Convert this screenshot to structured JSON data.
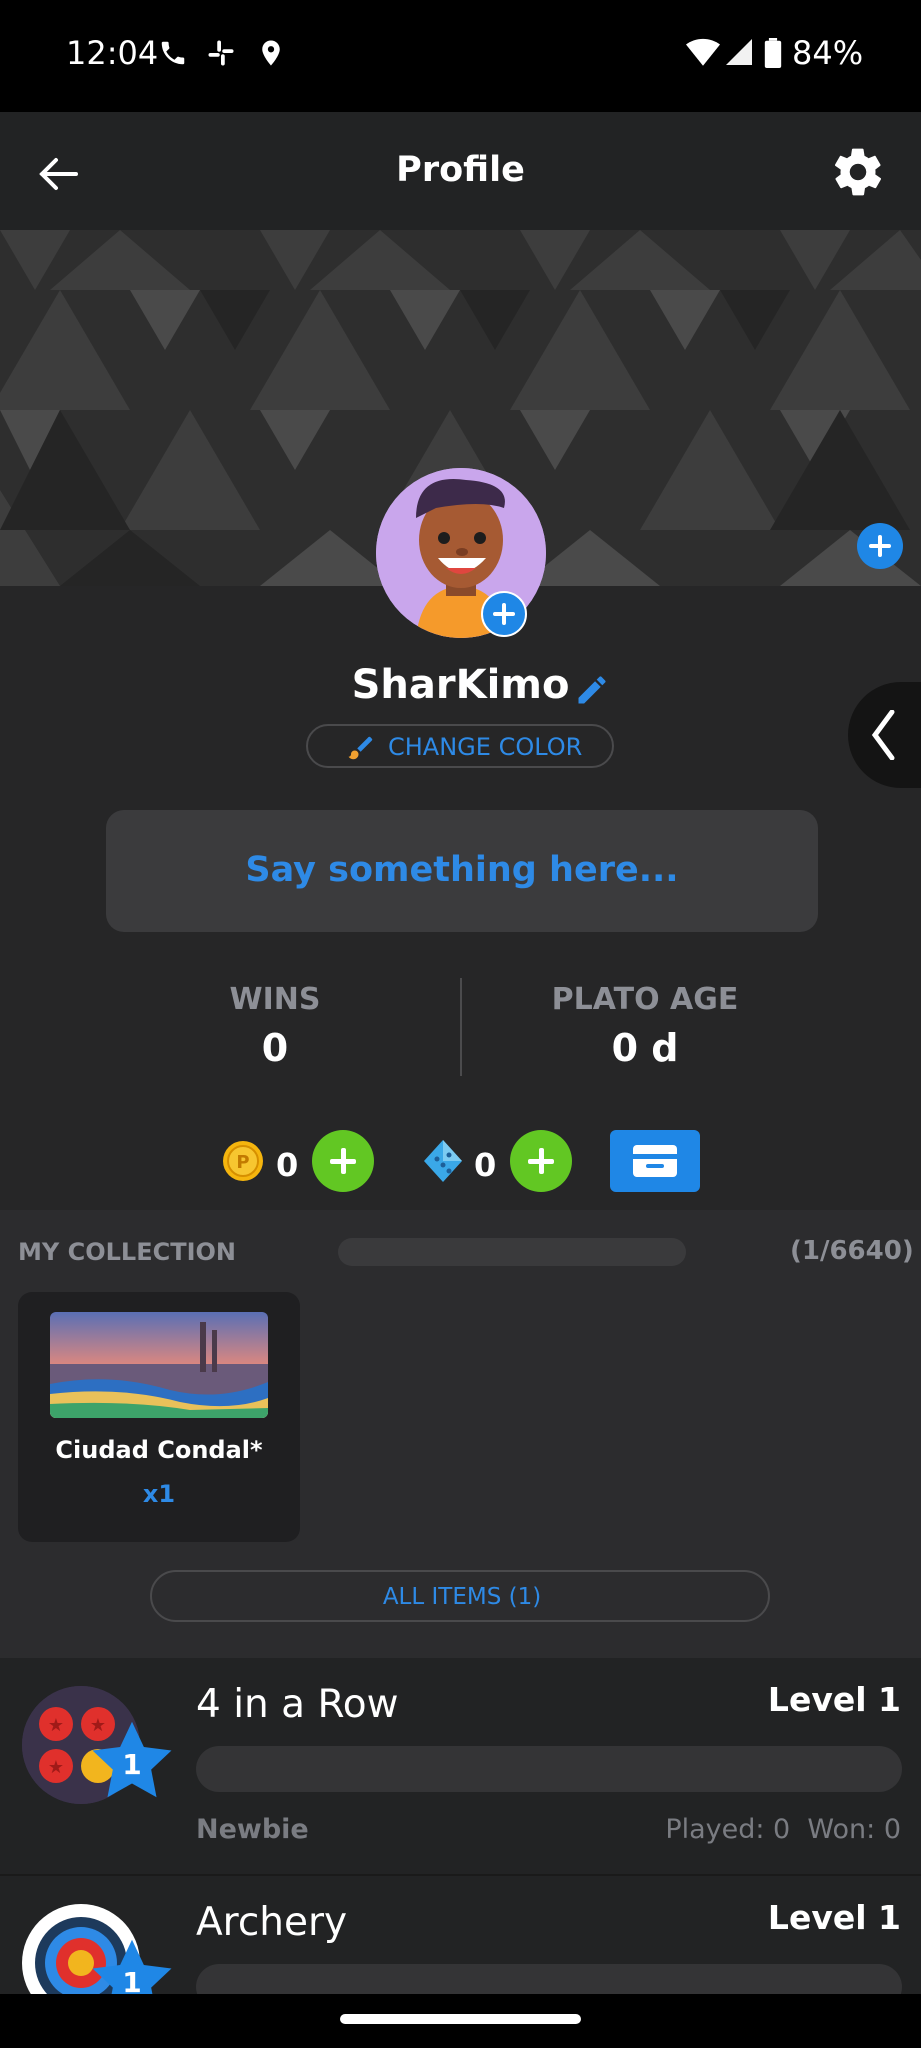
{
  "status_bar": {
    "time": "12:04",
    "battery": "84%",
    "icons": [
      "phone-icon",
      "slack-icon",
      "location-icon",
      "wifi-icon",
      "signal-icon",
      "battery-icon"
    ]
  },
  "header": {
    "title": "Profile",
    "back_icon": "arrow-left-icon",
    "settings_icon": "gear-icon"
  },
  "profile": {
    "username": "SharKimo",
    "change_color_label": "CHANGE COLOR",
    "status_placeholder": "Say something here..."
  },
  "stats": {
    "wins_label": "WINS",
    "wins_value": "0",
    "age_label": "PLATO AGE",
    "age_value": "0 d"
  },
  "currency": {
    "coins": "0",
    "gems": "0"
  },
  "collection": {
    "title": "MY COLLECTION",
    "count": "(1/6640)",
    "items": [
      {
        "name": "Ciudad Condal*",
        "qty": "x1"
      }
    ],
    "all_items_label": "ALL ITEMS (1)"
  },
  "games": [
    {
      "name": "4 in a Row",
      "level": "Level 1",
      "badge": "1",
      "rank": "Newbie",
      "stats": "Played: 0  Won: 0"
    },
    {
      "name": "Archery",
      "level": "Level 1",
      "badge": "1"
    }
  ],
  "colors": {
    "accent": "#2e8ae6",
    "add_green": "#62c723",
    "background": "#262627"
  }
}
